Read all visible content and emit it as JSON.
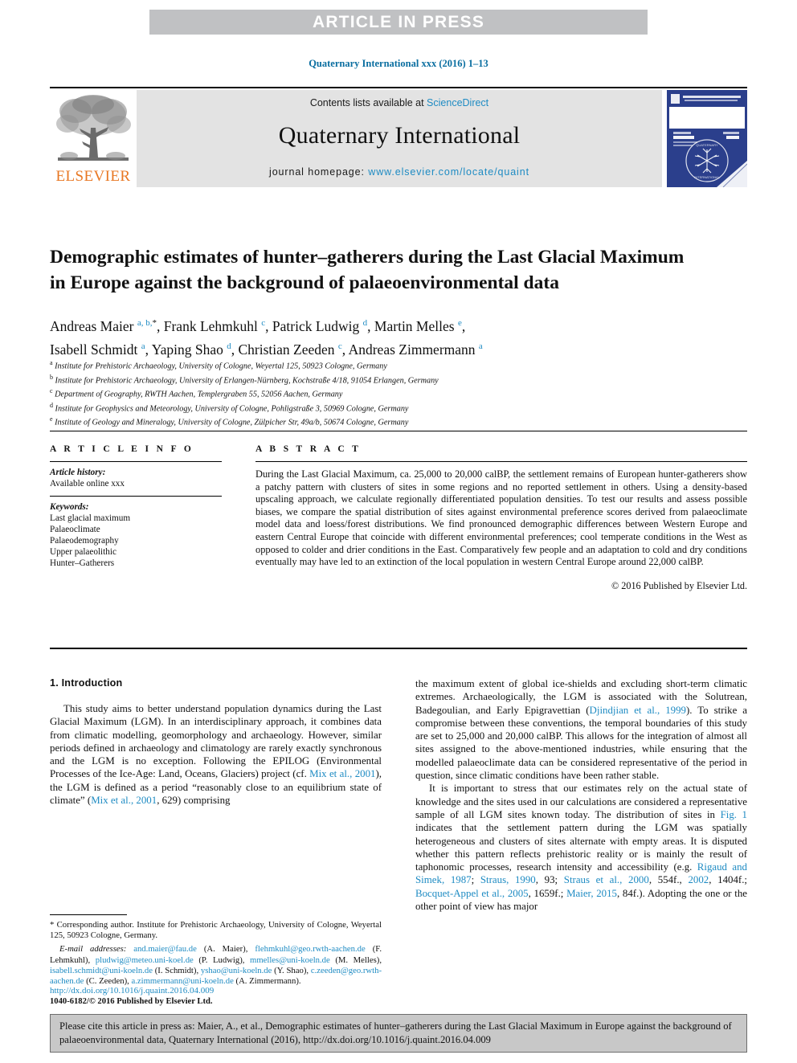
{
  "banner": {
    "text": "ARTICLE IN PRESS"
  },
  "journal_ref": "Quaternary International xxx (2016) 1–13",
  "masthead": {
    "contents_prefix": "Contents lists available at ",
    "sciencedirect": "ScienceDirect",
    "journal_title": "Quaternary International",
    "homepage_label": "journal homepage: ",
    "homepage_url": "www.elsevier.com/locate/quaint",
    "publisher_wordmark": "ELSEVIER",
    "cover_title": "QUATERNARY INTERNATIONAL",
    "cover_subtitle": "The Journal of the International Union for Quaternary Research"
  },
  "paper": {
    "title": "Demographic estimates of hunter–gatherers during the Last Glacial Maximum in Europe against the background of palaeoenvironmental data",
    "authors_line_1": "Andreas Maier",
    "authors": [
      {
        "name": "Andreas Maier",
        "marks": "a, b,",
        "star": true
      },
      {
        "name": "Frank Lehmkuhl",
        "marks": "c",
        "star": false
      },
      {
        "name": "Patrick Ludwig",
        "marks": "d",
        "star": false
      },
      {
        "name": "Martin Melles",
        "marks": "e",
        "star": false
      },
      {
        "name": "Isabell Schmidt",
        "marks": "a",
        "star": false
      },
      {
        "name": "Yaping Shao",
        "marks": "d",
        "star": false
      },
      {
        "name": "Christian Zeeden",
        "marks": "c",
        "star": false
      },
      {
        "name": "Andreas Zimmermann",
        "marks": "a",
        "star": false
      }
    ],
    "affiliations": [
      {
        "mark": "a",
        "text": "Institute for Prehistoric Archaeology, University of Cologne, Weyertal 125, 50923 Cologne, Germany"
      },
      {
        "mark": "b",
        "text": "Institute for Prehistoric Archaeology, University of Erlangen-Nürnberg, Kochstraße 4/18, 91054 Erlangen, Germany"
      },
      {
        "mark": "c",
        "text": "Department of Geography, RWTH Aachen, Templergraben 55, 52056 Aachen, Germany"
      },
      {
        "mark": "d",
        "text": "Institute for Geophysics and Meteorology, University of Cologne, Pohligstraße 3, 50969 Cologne, Germany"
      },
      {
        "mark": "e",
        "text": "Institute of Geology and Mineralogy, University of Cologne, Zülpicher Str, 49a/b, 50674 Cologne, Germany"
      }
    ]
  },
  "article_info": {
    "heading": "A R T I C L E   I N F O",
    "history_label": "Article history:",
    "history_value": "Available online xxx",
    "keywords_label": "Keywords:",
    "keywords": [
      "Last glacial maximum",
      "Palaeoclimate",
      "Palaeodemography",
      "Upper palaeolithic",
      "Hunter–Gatherers"
    ]
  },
  "abstract": {
    "heading": "A B S T R A C T",
    "text": "During the Last Glacial Maximum, ca. 25,000 to 20,000 calBP, the settlement remains of European hunter-gatherers show a patchy pattern with clusters of sites in some regions and no reported settlement in others. Using a density-based upscaling approach, we calculate regionally differentiated population densities. To test our results and assess possible biases, we compare the spatial distribution of sites against environmental preference scores derived from palaeoclimate model data and loess/forest distributions. We find pronounced demographic differences between Western Europe and eastern Central Europe that coincide with different environmental preferences; cool temperate conditions in the West as opposed to colder and drier conditions in the East. Comparatively few people and an adaptation to cold and dry conditions eventually may have led to an extinction of the local population in western Central Europe around 22,000 calBP.",
    "copyright": "© 2016 Published by Elsevier Ltd."
  },
  "body": {
    "section_heading": "1. Introduction",
    "left_paragraphs": [
      "This study aims to better understand population dynamics during the Last Glacial Maximum (LGM). In an interdisciplinary approach, it combines data from climatic modelling, geomorphology and archaeology. However, similar periods defined in archaeology and climatology are rarely exactly synchronous and the LGM is no exception. Following the EPILOG (Environmental Processes of the Ice-Age: Land, Oceans, Glaciers) project (cf. Mix et al., 2001), the LGM is defined as a period “reasonably close to an equilibrium state of climate” (Mix et al., 2001, 629) comprising"
    ],
    "right_paragraphs": [
      "the maximum extent of global ice-shields and excluding short-term climatic extremes. Archaeologically, the LGM is associated with the Solutrean, Badegoulian, and Early Epigravettian (Djindjian et al., 1999). To strike a compromise between these conventions, the temporal boundaries of this study are set to 25,000 and 20,000 calBP. This allows for the integration of almost all sites assigned to the above-mentioned industries, while ensuring that the modelled palaeoclimate data can be considered representative of the period in question, since climatic conditions have been rather stable.",
      "It is important to stress that our estimates rely on the actual state of knowledge and the sites used in our calculations are considered a representative sample of all LGM sites known today. The distribution of sites in Fig. 1 indicates that the settlement pattern during the LGM was spatially heterogeneous and clusters of sites alternate with empty areas. It is disputed whether this pattern reflects prehistoric reality or is mainly the result of taphonomic processes, research intensity and accessibility (e.g. Rigaud and Simek, 1987; Straus, 1990, 93; Straus et al., 2000, 554f., 2002, 1404f.; Bocquet-Appel et al., 2005, 1659f.; Maier, 2015, 84f.). Adopting the one or the other point of view has major"
    ]
  },
  "footnote": {
    "corresponding": "* Corresponding author. Institute for Prehistoric Archaeology, University of Cologne, Weyertal 125, 50923 Cologne, Germany.",
    "emails_label": "E-mail addresses:",
    "emails": [
      {
        "email": "and.maier@fau.de",
        "who": "(A. Maier),"
      },
      {
        "email": "flehmkuhl@geo.rwth-aachen.de",
        "who": "(F. Lehmkuhl),"
      },
      {
        "email": "pludwig@meteo.uni-koel.de",
        "who": "(P. Ludwig),"
      },
      {
        "email": "mmelles@uni-koeln.de",
        "who": "(M. Melles),"
      },
      {
        "email": "isabell.schmidt@uni-koeln.de",
        "who": "(I. Schmidt),"
      },
      {
        "email": "yshao@uni-koeln.de",
        "who": "(Y. Shao),"
      },
      {
        "email": "c.zeeden@geo.rwth-aachen.de",
        "who": "(C. Zeeden),"
      },
      {
        "email": "a.zimmermann@uni-koeln.de",
        "who": "(A. Zimmermann)."
      }
    ]
  },
  "doi_block": {
    "doi_url": "http://dx.doi.org/10.1016/j.quaint.2016.04.009",
    "issn_line": "1040-6182/© 2016 Published by Elsevier Ltd."
  },
  "citation_box": {
    "text": "Please cite this article in press as: Maier, A., et al., Demographic estimates of hunter–gatherers during the Last Glacial Maximum in Europe against the background of palaeoenvironmental data, Quaternary International (2016), http://dx.doi.org/10.1016/j.quaint.2016.04.009"
  },
  "colors": {
    "accent_blue": "#1e8bc3",
    "ref_blue": "#0a6ea0",
    "elsevier_orange": "#e87722",
    "banner_gray": "#c0c1c3",
    "masthead_gray": "#e3e3e3",
    "cite_gray": "#c8c8c8",
    "cover_blue": "#2b3f8c"
  }
}
